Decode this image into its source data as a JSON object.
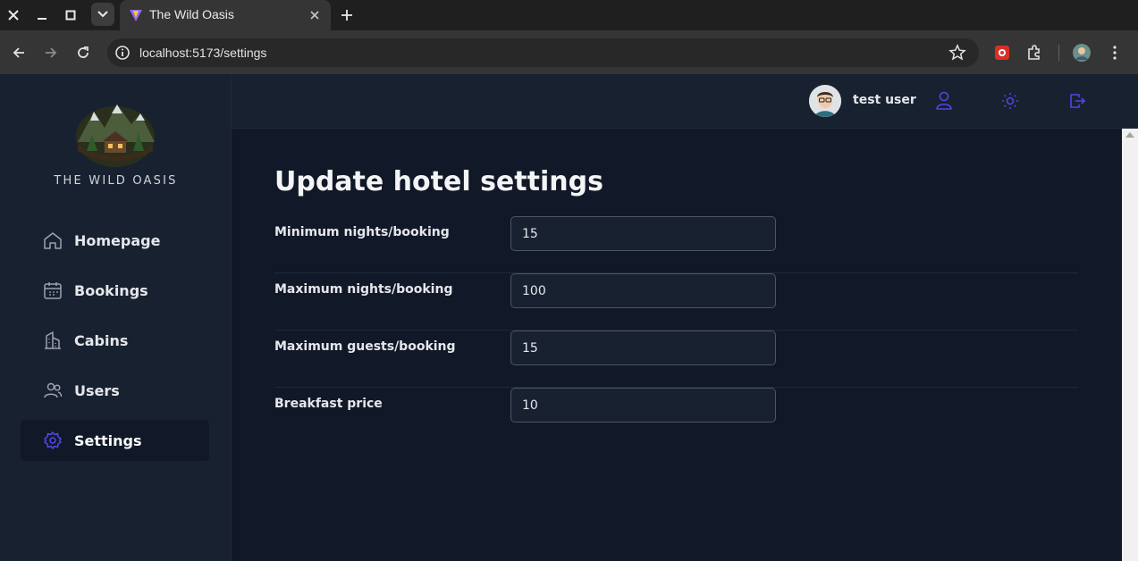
{
  "browser": {
    "tab_title": "The Wild Oasis",
    "url": "localhost:5173/settings"
  },
  "app": {
    "brand": "THE WILD OASIS",
    "nav": [
      {
        "label": "Homepage",
        "icon": "home-icon"
      },
      {
        "label": "Bookings",
        "icon": "calendar-icon"
      },
      {
        "label": "Cabins",
        "icon": "building-icon"
      },
      {
        "label": "Users",
        "icon": "users-icon"
      },
      {
        "label": "Settings",
        "icon": "gear-icon",
        "active": true
      }
    ],
    "header": {
      "username": "test user"
    },
    "accent_color": "#4f46e5"
  },
  "settings": {
    "title": "Update hotel settings",
    "fields": [
      {
        "label": "Minimum nights/booking",
        "value": "15"
      },
      {
        "label": "Maximum nights/booking",
        "value": "100"
      },
      {
        "label": "Maximum guests/booking",
        "value": "15"
      },
      {
        "label": "Breakfast price",
        "value": "10"
      }
    ]
  }
}
